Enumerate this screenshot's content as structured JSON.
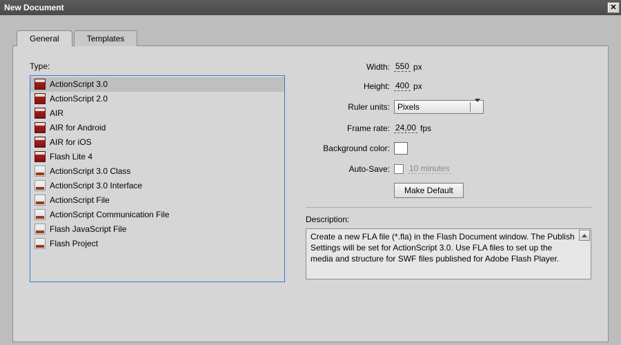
{
  "window": {
    "title": "New Document"
  },
  "tabs": {
    "general": "General",
    "templates": "Templates"
  },
  "type_label": "Type:",
  "types": [
    {
      "label": "ActionScript 3.0",
      "icon": "red"
    },
    {
      "label": "ActionScript 2.0",
      "icon": "red"
    },
    {
      "label": "AIR",
      "icon": "red"
    },
    {
      "label": "AIR for Android",
      "icon": "red"
    },
    {
      "label": "AIR for iOS",
      "icon": "red"
    },
    {
      "label": "Flash Lite 4",
      "icon": "red"
    },
    {
      "label": "ActionScript 3.0 Class",
      "icon": "gray"
    },
    {
      "label": "ActionScript 3.0 Interface",
      "icon": "gray"
    },
    {
      "label": "ActionScript File",
      "icon": "gray"
    },
    {
      "label": "ActionScript Communication File",
      "icon": "gray"
    },
    {
      "label": "Flash JavaScript File",
      "icon": "gray"
    },
    {
      "label": "Flash Project",
      "icon": "gray"
    }
  ],
  "form": {
    "width_label": "Width:",
    "width_value": "550",
    "height_label": "Height:",
    "height_value": "400",
    "px": "px",
    "ruler_label": "Ruler units:",
    "ruler_value": "Pixels",
    "framerate_label": "Frame rate:",
    "framerate_value": "24,00",
    "fps": "fps",
    "bg_label": "Background color:",
    "autosave_label": "Auto-Save:",
    "autosave_interval": "10 minutes",
    "make_default": "Make Default"
  },
  "description": {
    "label": "Description:",
    "text": "Create a new FLA file (*.fla) in the Flash Document window. The Publish Settings will be set for ActionScript 3.0. Use FLA files to set up the media and structure for SWF files published for Adobe Flash Player."
  }
}
